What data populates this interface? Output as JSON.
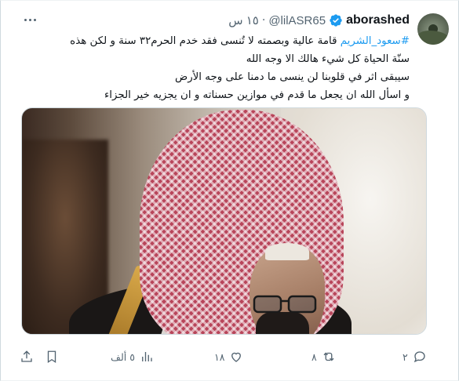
{
  "post": {
    "author": {
      "display_name": "aborashed",
      "handle": "@lilASR65",
      "verified": true,
      "avatar_icon": "avatar-landscape"
    },
    "separator": "·",
    "time": "١٥ س",
    "text": {
      "hashtag": "#سعود_الشريم",
      "line1_rest": " قامة عالية وبصمته لا تُنسى فقد خدم الحرم٣٢ سنة و لكن هذه",
      "line2": "سنّة الحياة كل شيء هالك الا وجه الله",
      "line3": "سيبقى اثر في قلوبنا لن ينسى ما دمنا على وجه الأرض",
      "line4": "و اسأل الله ان يجعل ما قدم في موازين حسناته و ان يجزيه خير الجزاء"
    },
    "media": {
      "type": "photo"
    },
    "actions": {
      "reply_count": "٢",
      "repost_count": "٨",
      "like_count": "١٨",
      "views_count": "٥ ألف",
      "reply_icon": "reply-icon",
      "repost_icon": "repost-icon",
      "like_icon": "heart-icon",
      "views_icon": "views-chart-icon",
      "bookmark_icon": "bookmark-icon",
      "share_icon": "share-icon"
    }
  },
  "colors": {
    "accent": "#1d9bf0",
    "muted": "#536471",
    "text": "#0f1419"
  }
}
